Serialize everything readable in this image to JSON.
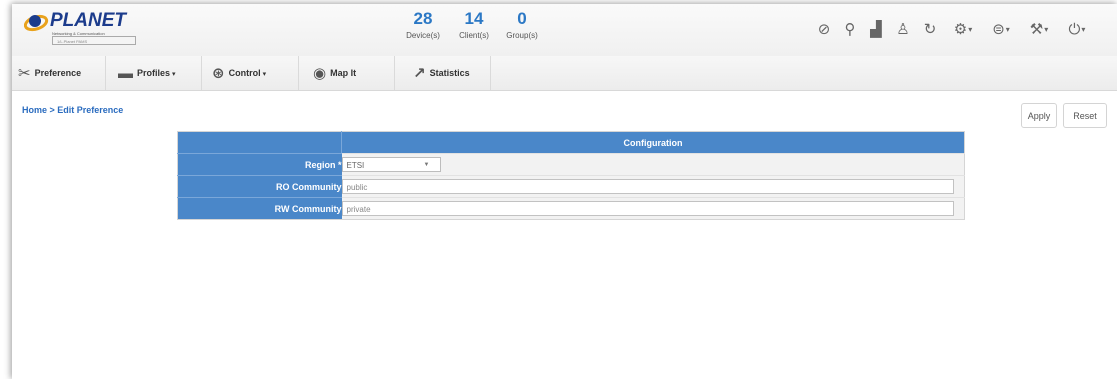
{
  "brand": {
    "name": "PLANET",
    "tagline": "Networking & Communication",
    "device_field": "1/L.Planet PAMS"
  },
  "counts": [
    {
      "value": "28",
      "label": "Device(s)"
    },
    {
      "value": "14",
      "label": "Client(s)"
    },
    {
      "value": "0",
      "label": "Group(s)"
    }
  ],
  "toolbar_icons": [
    {
      "name": "dashboard-icon",
      "glyph": "⊘",
      "dropdown": false
    },
    {
      "name": "location-pin-icon",
      "glyph": "⚲",
      "dropdown": false
    },
    {
      "name": "bar-chart-icon",
      "glyph": "▟",
      "dropdown": false
    },
    {
      "name": "users-icon",
      "glyph": "♙",
      "dropdown": false
    },
    {
      "name": "refresh-icon",
      "glyph": "↻",
      "dropdown": false
    },
    {
      "name": "gear-icon",
      "glyph": "⚙",
      "dropdown": true
    },
    {
      "name": "list-icon",
      "glyph": "⊜",
      "dropdown": true
    },
    {
      "name": "wrench-icon",
      "glyph": "⚒",
      "dropdown": true
    },
    {
      "name": "power-icon",
      "glyph": "⏻",
      "dropdown": true
    }
  ],
  "menu": {
    "preference": "Preference",
    "profiles": "Profiles",
    "control": "Control",
    "map_it": "Map It",
    "statistics": "Statistics"
  },
  "breadcrumb": "Home > Edit Preference",
  "buttons": {
    "apply": "Apply",
    "reset": "Reset"
  },
  "config": {
    "header": "Configuration",
    "region_label": "Region",
    "region_required": "*",
    "region_value": "ETSI",
    "ro_label": "RO Community",
    "ro_value": "public",
    "rw_label": "RW Community",
    "rw_value": "private"
  },
  "colors": {
    "accent": "#4a87c9",
    "count_blue": "#2b78c5",
    "link_blue": "#2b6cbf"
  }
}
